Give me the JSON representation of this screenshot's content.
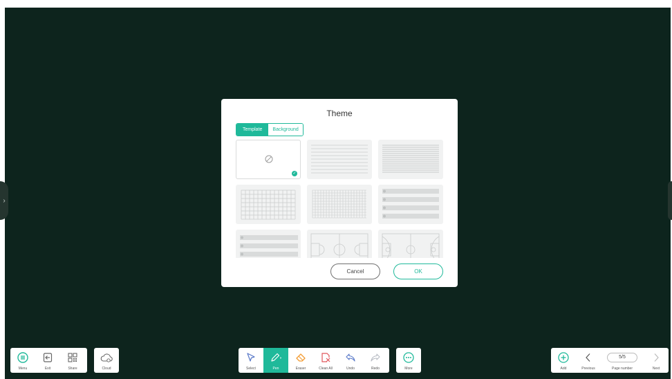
{
  "dialog": {
    "title": "Theme",
    "tabs": [
      {
        "label": "Template",
        "active": true
      },
      {
        "label": "Background",
        "active": false
      }
    ],
    "templates": [
      {
        "name": "none",
        "selected": true
      },
      {
        "name": "ruled-lines"
      },
      {
        "name": "ruled-lines-dense"
      },
      {
        "name": "grid"
      },
      {
        "name": "grid-fine"
      },
      {
        "name": "music-staff"
      },
      {
        "name": "music-staff-2"
      },
      {
        "name": "basketball-court"
      },
      {
        "name": "basketball-court-2"
      }
    ],
    "cancel_label": "Cancel",
    "ok_label": "OK"
  },
  "toolbar": {
    "left": [
      {
        "label": "Menu",
        "icon": "menu-icon"
      },
      {
        "label": "Exit",
        "icon": "exit-icon"
      },
      {
        "label": "Share",
        "icon": "qr-code-icon"
      }
    ],
    "cloud": {
      "label": "Cloud",
      "icon": "cloud-icon"
    },
    "center": [
      {
        "label": "Select",
        "icon": "select-pointer-icon"
      },
      {
        "label": "Pen",
        "icon": "pen-icon",
        "active": true
      },
      {
        "label": "Eraser",
        "icon": "eraser-icon"
      },
      {
        "label": "Clean All",
        "icon": "clean-all-icon"
      },
      {
        "label": "Undo",
        "icon": "undo-icon"
      },
      {
        "label": "Redo",
        "icon": "redo-icon"
      }
    ],
    "more": {
      "label": "More",
      "icon": "more-icon"
    },
    "right": {
      "add_label": "Add",
      "previous_label": "Previous",
      "page_value": "5/5",
      "page_label": "Page number",
      "next_label": "Next"
    }
  },
  "colors": {
    "accent": "#1fb99a",
    "board": "#0d241d",
    "eraser": "#f39c33",
    "clean_all": "#e0565b"
  }
}
